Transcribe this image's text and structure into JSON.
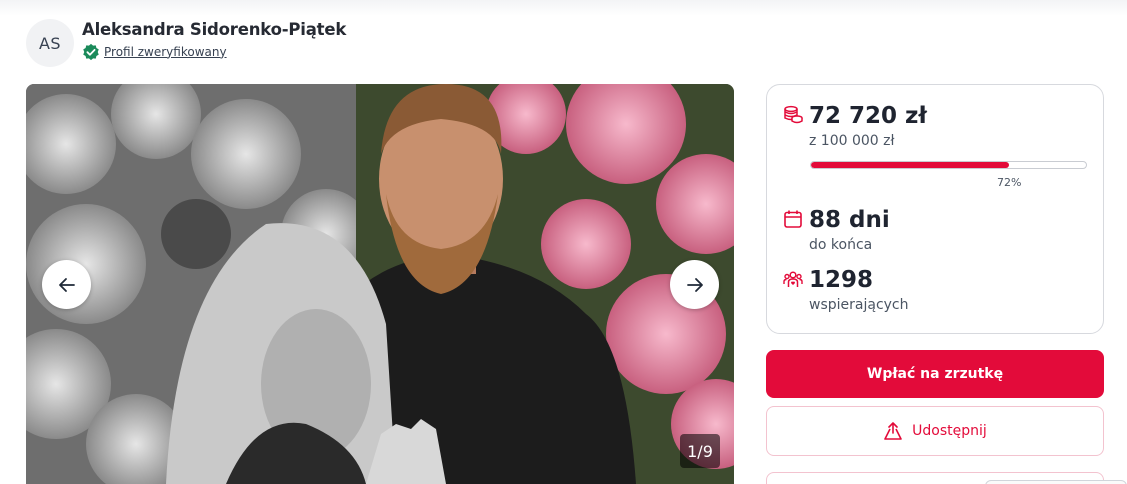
{
  "author": {
    "initials": "AS",
    "name": "Aleksandra Sidorenko-Piątek",
    "verified_label": "Profil zweryfikowany"
  },
  "gallery": {
    "counter": "1/9",
    "prev_icon": "arrow-left-icon",
    "next_icon": "arrow-right-icon"
  },
  "stats": {
    "raised": "72 720 zł",
    "goal": "z 100 000 zł",
    "progress_percent": 72,
    "progress_label": "72%",
    "days": "88 dni",
    "days_sub": "do końca",
    "supporters": "1298",
    "supporters_sub": "wspierających"
  },
  "actions": {
    "donate_label": "Wpłać na zrzutkę",
    "share_label": "Udostępnij"
  },
  "colors": {
    "accent": "#e30b3a",
    "verified": "#1a8a5a"
  }
}
